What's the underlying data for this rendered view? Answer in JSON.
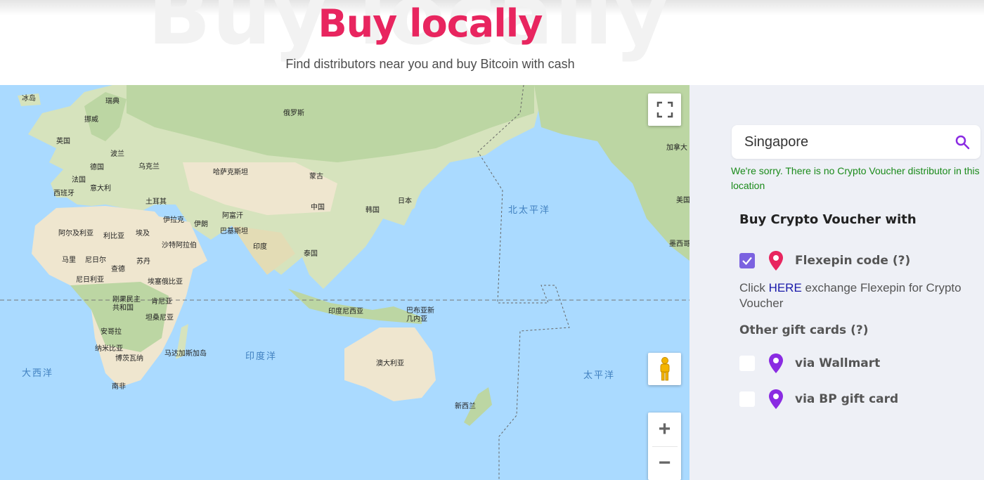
{
  "header": {
    "watermark": "Buy locally",
    "title": "Buy locally",
    "subtitle": "Find distributors near you and buy Bitcoin with cash"
  },
  "map": {
    "labels": {
      "iceland": "冰岛",
      "sweden": "瑞典",
      "norway": "挪威",
      "russia": "俄罗斯",
      "uk": "英国",
      "poland": "波兰",
      "germany": "德国",
      "ukraine": "乌克兰",
      "france": "法国",
      "italy": "意大利",
      "spain": "西班牙",
      "kazakhstan": "哈萨克斯坦",
      "mongolia": "蒙古",
      "turkey": "土耳其",
      "iraq": "伊拉克",
      "iran": "伊朗",
      "afghanistan": "阿富汗",
      "pakistan": "巴基斯坦",
      "china": "中国",
      "korea": "韩国",
      "japan": "日本",
      "algeria": "阿尔及利亚",
      "libya": "利比亚",
      "egypt": "埃及",
      "saudi": "沙特阿拉伯",
      "india": "印度",
      "thailand": "泰国",
      "mali": "马里",
      "niger": "尼日尔",
      "sudan": "苏丹",
      "chad": "查德",
      "nigeria": "尼日利亚",
      "ethiopia": "埃塞俄比亚",
      "drc": "刚果民主共和国",
      "kenya": "肯尼亚",
      "tanzania": "坦桑尼亚",
      "angola": "安哥拉",
      "namibia": "纳米比亚",
      "botswana": "博茨瓦纳",
      "madagascar": "马达加斯加岛",
      "south_africa": "南非",
      "indonesia": "印度尼西亚",
      "png": "巴布亚新几内亚",
      "australia": "澳大利亚",
      "new_zealand": "新西兰",
      "canada": "加拿大",
      "usa": "美国",
      "mexico": "墨西哥"
    },
    "oceans": {
      "north_pacific": "北太平洋",
      "pacific": "太平洋",
      "indian": "印度洋",
      "atlantic": "大西洋"
    },
    "controls": {
      "fullscreen_icon": "fullscreen-icon",
      "pegman_icon": "pegman-icon",
      "zoom_in": "+",
      "zoom_out": "−"
    },
    "colors": {
      "water": "#aadaff",
      "land": "#e6ecd2",
      "forest": "#bcd6a3",
      "desert": "#f2ead5"
    }
  },
  "panel": {
    "search": {
      "value": "Singapore",
      "icon": "search-icon"
    },
    "message": "We're sorry. There is no Crypto Voucher distributor in this location",
    "heading": "Buy Crypto Voucher with",
    "options": {
      "flexepin": {
        "label": "Flexepin code (?)",
        "checked": true,
        "pin_color": "#e8255f"
      },
      "wallmart": {
        "label": "via Wallmart",
        "checked": false,
        "pin_color": "#8a2be2"
      },
      "bp": {
        "label": "via BP gift card",
        "checked": false,
        "pin_color": "#8a2be2"
      }
    },
    "note": {
      "prefix": "Click ",
      "link": "HERE",
      "suffix": " exchange Flexepin for Crypto Voucher"
    },
    "other_heading": "Other gift cards (?)"
  }
}
